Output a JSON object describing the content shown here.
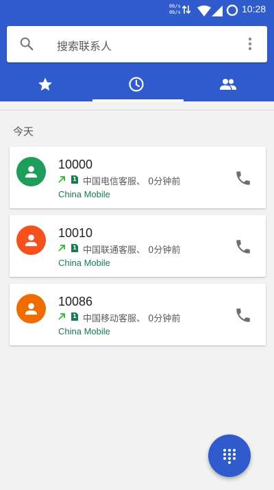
{
  "status_bar": {
    "net_speed_top": "0b/s",
    "net_speed_bottom": "0b/s",
    "time": "10:28"
  },
  "search": {
    "placeholder": "搜索联系人"
  },
  "tabs": [
    {
      "id": "favorites",
      "icon": "star-icon"
    },
    {
      "id": "recents",
      "icon": "clock-icon",
      "selected": true
    },
    {
      "id": "contacts",
      "icon": "people-icon"
    }
  ],
  "recents": {
    "section_title": "今天",
    "calls": [
      {
        "number": "10000",
        "description": "中国电信客服、 0分钟前",
        "sim": "1",
        "carrier": "China Mobile",
        "avatar_color": "#1e9e5a",
        "call_type": "outgoing"
      },
      {
        "number": "10010",
        "description": "中国联通客服、 0分钟前",
        "sim": "1",
        "carrier": "China Mobile",
        "avatar_color": "#f4511e",
        "call_type": "outgoing"
      },
      {
        "number": "10086",
        "description": "中国移动客服、 0分钟前",
        "sim": "1",
        "carrier": "China Mobile",
        "avatar_color": "#ef6c00",
        "call_type": "outgoing"
      }
    ]
  },
  "colors": {
    "primary": "#2f5bcc",
    "outgoing_arrow": "#2eb82e",
    "carrier_text": "#1a7a50"
  }
}
